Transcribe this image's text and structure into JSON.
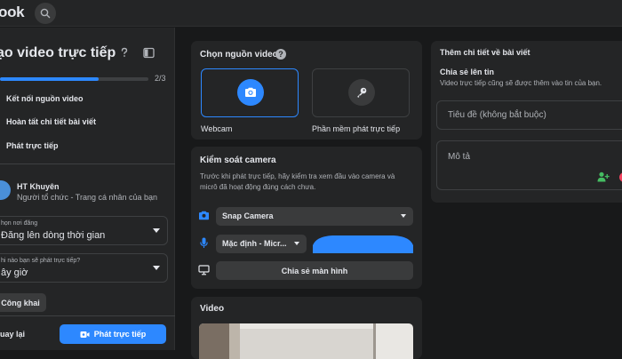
{
  "header": {
    "logo_text": "ook",
    "search_icon": "search-icon"
  },
  "sidebar": {
    "title": "ạo video trực tiếp",
    "progress_text": "2/3",
    "progress_fraction": 0.667,
    "steps": [
      {
        "label": "Kết nối nguồn video"
      },
      {
        "label": "Hoàn tất chi tiết bài viết"
      },
      {
        "label": "Phát trực tiếp"
      }
    ],
    "user": {
      "name": "HT Khuyên",
      "role": "Người tổ chức - Trang cá nhân của bạn"
    },
    "post_location": {
      "label": "họn nơi đăng",
      "value": "Đăng lên dòng thời gian"
    },
    "schedule": {
      "label": "hi nào bạn sẽ phát trực tiếp?",
      "value": "ây giờ"
    },
    "privacy_label": "Công khai",
    "back_label": "uay lại",
    "go_live_label": "Phát trực tiếp"
  },
  "video_source": {
    "title": "Chọn nguồn video",
    "options": [
      {
        "label": "Webcam",
        "icon": "camera-icon",
        "selected": true
      },
      {
        "label": "Phần mềm phát trực tiếp",
        "icon": "key-icon",
        "selected": false
      }
    ]
  },
  "camera_control": {
    "title": "Kiểm soát camera",
    "description_line1": "Trước khi phát trực tiếp, hãy kiểm tra xem đầu vào camera và",
    "description_line2": "micrô đã hoạt động đúng cách chưa.",
    "camera_select": "Snap Camera",
    "mic_select": "Mặc định - Micr...",
    "screen_share_label": "Chia sẻ màn hình"
  },
  "video_card": {
    "title": "Video"
  },
  "post_details": {
    "title": "Thêm chi tiết về bài viết",
    "share_title": "Chia sẻ lên tin",
    "share_desc": "Video trực tiếp cũng sẽ được thêm vào tin của bạn.",
    "title_placeholder": "Tiêu đề (không bắt buộc)",
    "description_placeholder": "Mô tả"
  },
  "colors": {
    "accent": "#2d88ff",
    "background": "#18191a",
    "surface": "#242526"
  }
}
